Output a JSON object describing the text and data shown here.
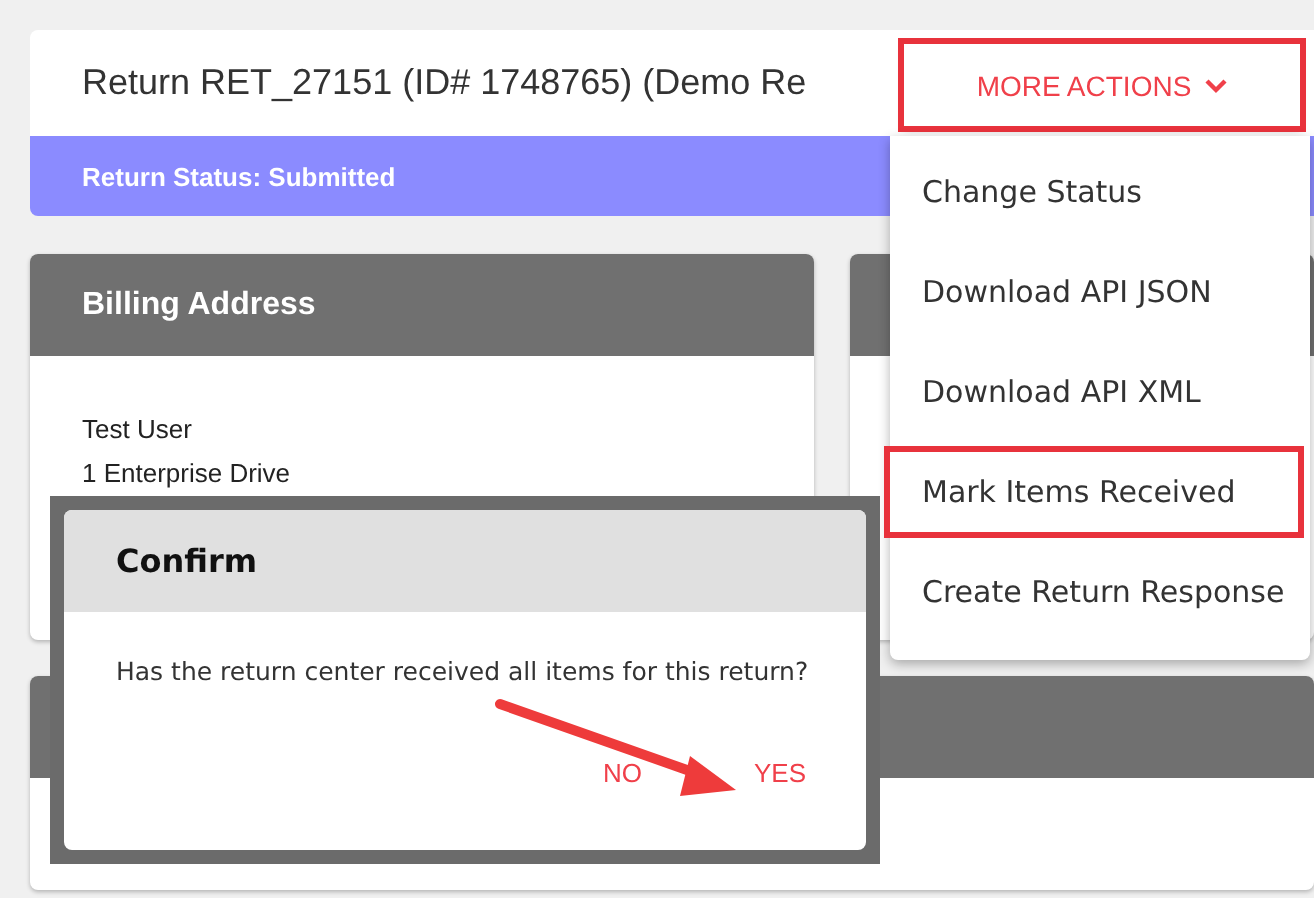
{
  "header": {
    "title": "Return RET_27151 (ID# 1748765) (Demo Re",
    "more_actions": {
      "label": "MORE ACTIONS",
      "expanded": true,
      "highlighted": true
    }
  },
  "status_bar": {
    "text": "Return Status: Submitted"
  },
  "billing_card": {
    "title": "Billing Address",
    "lines": [
      "Test User",
      "1 Enterprise Drive"
    ]
  },
  "dropdown_menu": {
    "items": [
      {
        "label": "Change Status",
        "highlighted": false
      },
      {
        "label": "Download API JSON",
        "highlighted": false
      },
      {
        "label": "Download API XML",
        "highlighted": false
      },
      {
        "label": "Mark Items Received",
        "highlighted": true
      },
      {
        "label": "Create Return Response",
        "highlighted": false
      }
    ]
  },
  "confirm_dialog": {
    "title": "Confirm",
    "message": "Has the return center received all items for this return?",
    "buttons": [
      {
        "label": "NO"
      },
      {
        "label": "YES"
      }
    ]
  }
}
